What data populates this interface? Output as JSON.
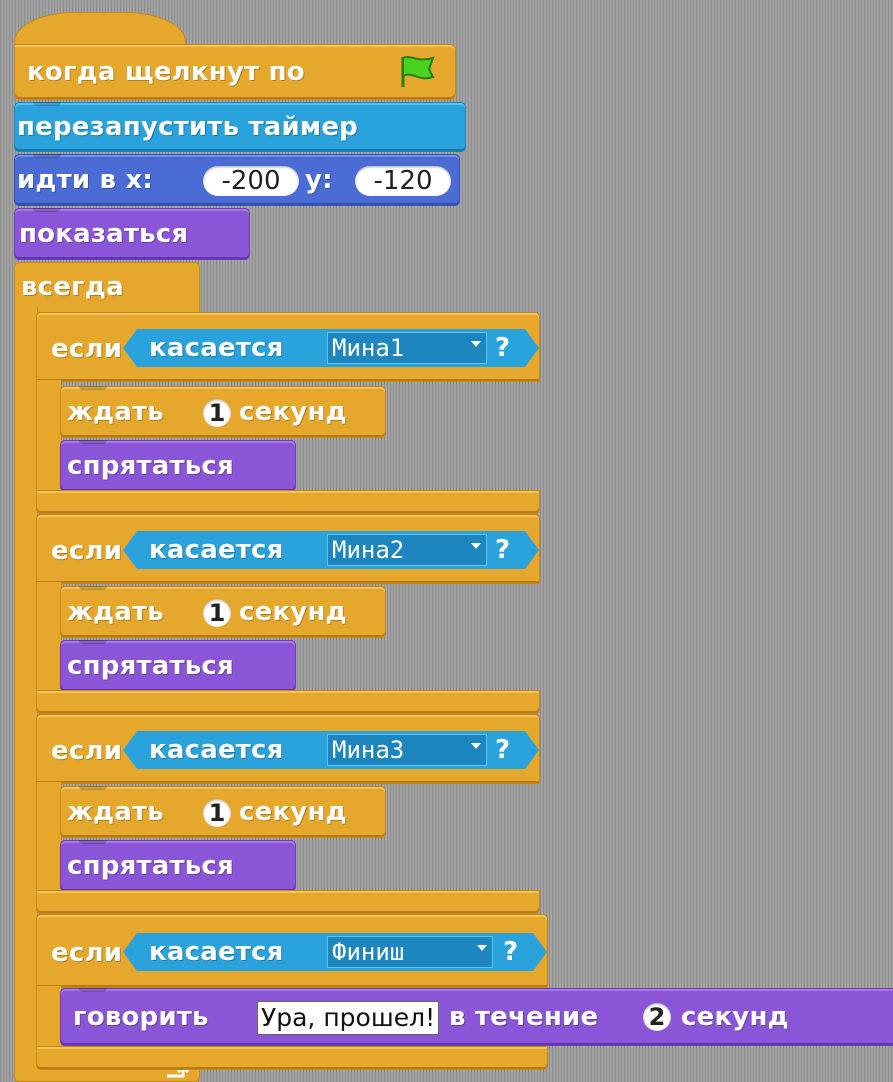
{
  "script": {
    "hat": {
      "label": "когда щелкнут по",
      "icon": "green-flag-icon"
    },
    "reset_timer": {
      "label": "перезапустить таймер"
    },
    "goto": {
      "label": "идти в x:",
      "x_value": "-200",
      "y_label": "y:",
      "y_value": "-120"
    },
    "show": {
      "label": "показаться"
    },
    "forever": {
      "label": "всегда"
    },
    "ifs": [
      {
        "if_label": "если",
        "sensing_label": "касается",
        "target": "Мина1",
        "qmark": "?",
        "wait_label": "ждать",
        "wait_value": "1",
        "wait_unit": "секунд",
        "hide_label": "спрятаться"
      },
      {
        "if_label": "если",
        "sensing_label": "касается",
        "target": "Мина2",
        "qmark": "?",
        "wait_label": "ждать",
        "wait_value": "1",
        "wait_unit": "секунд",
        "hide_label": "спрятаться"
      },
      {
        "if_label": "если",
        "sensing_label": "касается",
        "target": "Мина3",
        "qmark": "?",
        "wait_label": "ждать",
        "wait_value": "1",
        "wait_unit": "секунд",
        "hide_label": "спрятаться"
      }
    ],
    "finish_if": {
      "if_label": "если",
      "sensing_label": "касается",
      "target": "Финиш",
      "qmark": "?",
      "say_label": "говорить",
      "say_text": "Ура, прошел!",
      "during_label": "в течение",
      "say_secs": "2",
      "say_unit": "секунд"
    }
  },
  "colors": {
    "events": "#e6a82c",
    "control": "#e6a82c",
    "motion": "#4a6cd4",
    "looks": "#8a55d7",
    "sensing": "#2aa3dd"
  }
}
